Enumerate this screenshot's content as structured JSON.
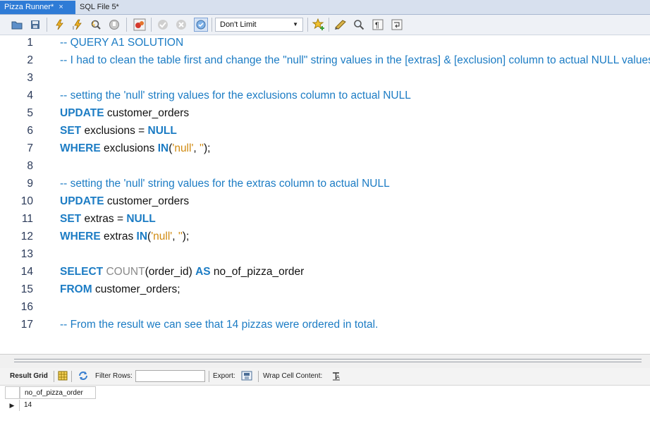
{
  "tabs": [
    {
      "label": "Pizza Runner*",
      "close": "×"
    },
    {
      "label": "SQL File 5*"
    }
  ],
  "toolbar": {
    "limit_value": "Don't Limit",
    "icons": [
      "open-folder-icon",
      "save-icon",
      "execute-icon",
      "execute-selection-icon",
      "explain-icon",
      "stop-icon",
      "toggle-error-icon",
      "commit-icon",
      "rollback-icon",
      "autocommit-icon",
      "bookmark-icon",
      "beautify-icon",
      "find-icon",
      "invisible-chars-icon",
      "wrap-icon"
    ]
  },
  "editor": {
    "lines": [
      {
        "n": "1",
        "segs": [
          {
            "t": "-- QUERY A1 SOLUTION",
            "c": "cm"
          }
        ]
      },
      {
        "n": "2",
        "segs": [
          {
            "t": "-- I had to clean the table first and change the \"null\" string values in the [extras] & [exclusion] column to actual NULL values",
            "c": "cm"
          }
        ]
      },
      {
        "n": "3",
        "segs": []
      },
      {
        "n": "4",
        "segs": [
          {
            "t": "-- setting the 'null' string values for the exclusions column to actual NULL",
            "c": "cm"
          }
        ]
      },
      {
        "n": "5",
        "segs": [
          {
            "t": "UPDATE",
            "c": "kw"
          },
          {
            "t": " customer_orders",
            "c": ""
          }
        ]
      },
      {
        "n": "6",
        "segs": [
          {
            "t": "SET",
            "c": "kw"
          },
          {
            "t": " exclusions = ",
            "c": ""
          },
          {
            "t": "NULL",
            "c": "kw"
          }
        ]
      },
      {
        "n": "7",
        "segs": [
          {
            "t": "WHERE",
            "c": "kw"
          },
          {
            "t": " exclusions ",
            "c": ""
          },
          {
            "t": "IN",
            "c": "kw"
          },
          {
            "t": "(",
            "c": ""
          },
          {
            "t": "'null'",
            "c": "str"
          },
          {
            "t": ", ",
            "c": ""
          },
          {
            "t": "''",
            "c": "str"
          },
          {
            "t": ");",
            "c": ""
          }
        ]
      },
      {
        "n": "8",
        "segs": []
      },
      {
        "n": "9",
        "segs": [
          {
            "t": "-- setting the 'null' string values for the extras column to actual NULL",
            "c": "cm"
          }
        ]
      },
      {
        "n": "10",
        "segs": [
          {
            "t": "UPDATE",
            "c": "kw"
          },
          {
            "t": " customer_orders",
            "c": ""
          }
        ]
      },
      {
        "n": "11",
        "segs": [
          {
            "t": "SET",
            "c": "kw"
          },
          {
            "t": " extras = ",
            "c": ""
          },
          {
            "t": "NULL",
            "c": "kw"
          }
        ]
      },
      {
        "n": "12",
        "segs": [
          {
            "t": "WHERE",
            "c": "kw"
          },
          {
            "t": " extras ",
            "c": ""
          },
          {
            "t": "IN",
            "c": "kw"
          },
          {
            "t": "(",
            "c": ""
          },
          {
            "t": "'null'",
            "c": "str"
          },
          {
            "t": ", ",
            "c": ""
          },
          {
            "t": "''",
            "c": "str"
          },
          {
            "t": ");",
            "c": ""
          }
        ]
      },
      {
        "n": "13",
        "segs": []
      },
      {
        "n": "14",
        "segs": [
          {
            "t": "SELECT",
            "c": "kw"
          },
          {
            "t": " COUNT",
            "c": "fn"
          },
          {
            "t": "(order_id) ",
            "c": ""
          },
          {
            "t": "AS",
            "c": "kw"
          },
          {
            "t": " no_of_pizza_order",
            "c": ""
          }
        ]
      },
      {
        "n": "15",
        "segs": [
          {
            "t": "FROM",
            "c": "kw"
          },
          {
            "t": " customer_orders;",
            "c": ""
          }
        ]
      },
      {
        "n": "16",
        "segs": []
      },
      {
        "n": "17",
        "segs": [
          {
            "t": "-- From the result we can see that 14 pizzas were ordered in total.",
            "c": "cm"
          }
        ]
      }
    ]
  },
  "result_toolbar": {
    "result_grid_label": "Result Grid",
    "filter_rows_label": "Filter Rows:",
    "filter_value": "",
    "export_label": "Export:",
    "wrap_label": "Wrap Cell Content:"
  },
  "grid": {
    "columns": [
      "no_of_pizza_order"
    ],
    "rows": [
      [
        "14"
      ]
    ],
    "row_marker": "▶"
  }
}
